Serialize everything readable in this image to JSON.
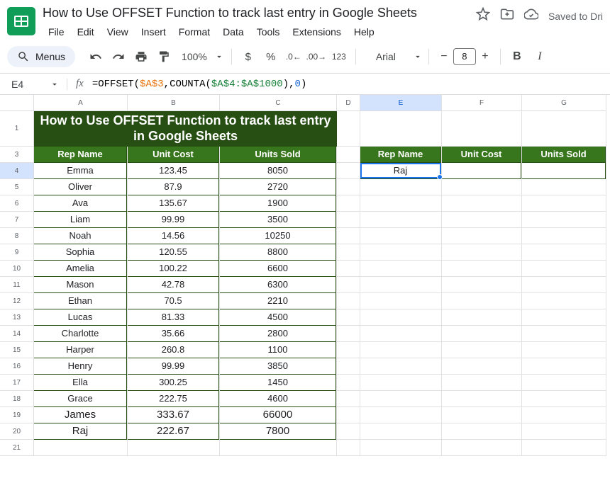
{
  "doc_title": "How to Use OFFSET Function to track last entry in Google Sheets",
  "saved_label": "Saved to Dri",
  "menus_label": "Menus",
  "menu": [
    "File",
    "Edit",
    "View",
    "Insert",
    "Format",
    "Data",
    "Tools",
    "Extensions",
    "Help"
  ],
  "zoom": "100%",
  "font_family": "Arial",
  "font_size": "8",
  "name_box": "E4",
  "formula_parts": {
    "p1": "=OFFSET(",
    "p2": "$A$3",
    "p3": ",",
    "p4": "COUNTA",
    "p5": "(",
    "p6": "$A$4:$A$1000",
    "p7": ")",
    "p8": ",",
    "p9": "0",
    "p10": ")"
  },
  "columns": [
    "A",
    "B",
    "C",
    "D",
    "E",
    "F",
    "G"
  ],
  "row_labels": [
    "1",
    "3",
    "4",
    "5",
    "6",
    "7",
    "8",
    "9",
    "10",
    "11",
    "12",
    "13",
    "14",
    "15",
    "16",
    "17",
    "18",
    "19",
    "20",
    "21"
  ],
  "title_cell": "How to Use OFFSET Function to track last entry in Google Sheets",
  "headers": {
    "a": "Rep Name",
    "b": "Unit Cost",
    "c": "Units Sold"
  },
  "headers2": {
    "e": "Rep Name",
    "f": "Unit Cost",
    "g": "Units Sold"
  },
  "data": [
    {
      "a": "Emma",
      "b": "123.45",
      "c": "8050"
    },
    {
      "a": "Oliver",
      "b": "87.9",
      "c": "2720"
    },
    {
      "a": "Ava",
      "b": "135.67",
      "c": "1900"
    },
    {
      "a": "Liam",
      "b": "99.99",
      "c": "3500"
    },
    {
      "a": "Noah",
      "b": "14.56",
      "c": "10250"
    },
    {
      "a": "Sophia",
      "b": "120.55",
      "c": "8800"
    },
    {
      "a": "Amelia",
      "b": "100.22",
      "c": "6600"
    },
    {
      "a": "Mason",
      "b": "42.78",
      "c": "6300"
    },
    {
      "a": "Ethan",
      "b": "70.5",
      "c": "2210"
    },
    {
      "a": "Lucas",
      "b": "81.33",
      "c": "4500"
    },
    {
      "a": "Charlotte",
      "b": "35.66",
      "c": "2800"
    },
    {
      "a": "Harper",
      "b": "260.8",
      "c": "1100"
    },
    {
      "a": "Henry",
      "b": "99.99",
      "c": "3850"
    },
    {
      "a": "Ella",
      "b": "300.25",
      "c": "1450"
    },
    {
      "a": "Grace",
      "b": "222.75",
      "c": "4600"
    },
    {
      "a": "James",
      "b": "333.67",
      "c": "66000"
    },
    {
      "a": "Raj",
      "b": "222.67",
      "c": "7800"
    }
  ],
  "result_e4": "Raj",
  "chart_data": {
    "type": "table",
    "headers": [
      "Rep Name",
      "Unit Cost",
      "Units Sold"
    ],
    "rows": [
      [
        "Emma",
        123.45,
        8050
      ],
      [
        "Oliver",
        87.9,
        2720
      ],
      [
        "Ava",
        135.67,
        1900
      ],
      [
        "Liam",
        99.99,
        3500
      ],
      [
        "Noah",
        14.56,
        10250
      ],
      [
        "Sophia",
        120.55,
        8800
      ],
      [
        "Amelia",
        100.22,
        6600
      ],
      [
        "Mason",
        42.78,
        6300
      ],
      [
        "Ethan",
        70.5,
        2210
      ],
      [
        "Lucas",
        81.33,
        4500
      ],
      [
        "Charlotte",
        35.66,
        2800
      ],
      [
        "Harper",
        260.8,
        1100
      ],
      [
        "Henry",
        99.99,
        3850
      ],
      [
        "Ella",
        300.25,
        1450
      ],
      [
        "Grace",
        222.75,
        4600
      ],
      [
        "James",
        333.67,
        66000
      ],
      [
        "Raj",
        222.67,
        7800
      ]
    ]
  }
}
